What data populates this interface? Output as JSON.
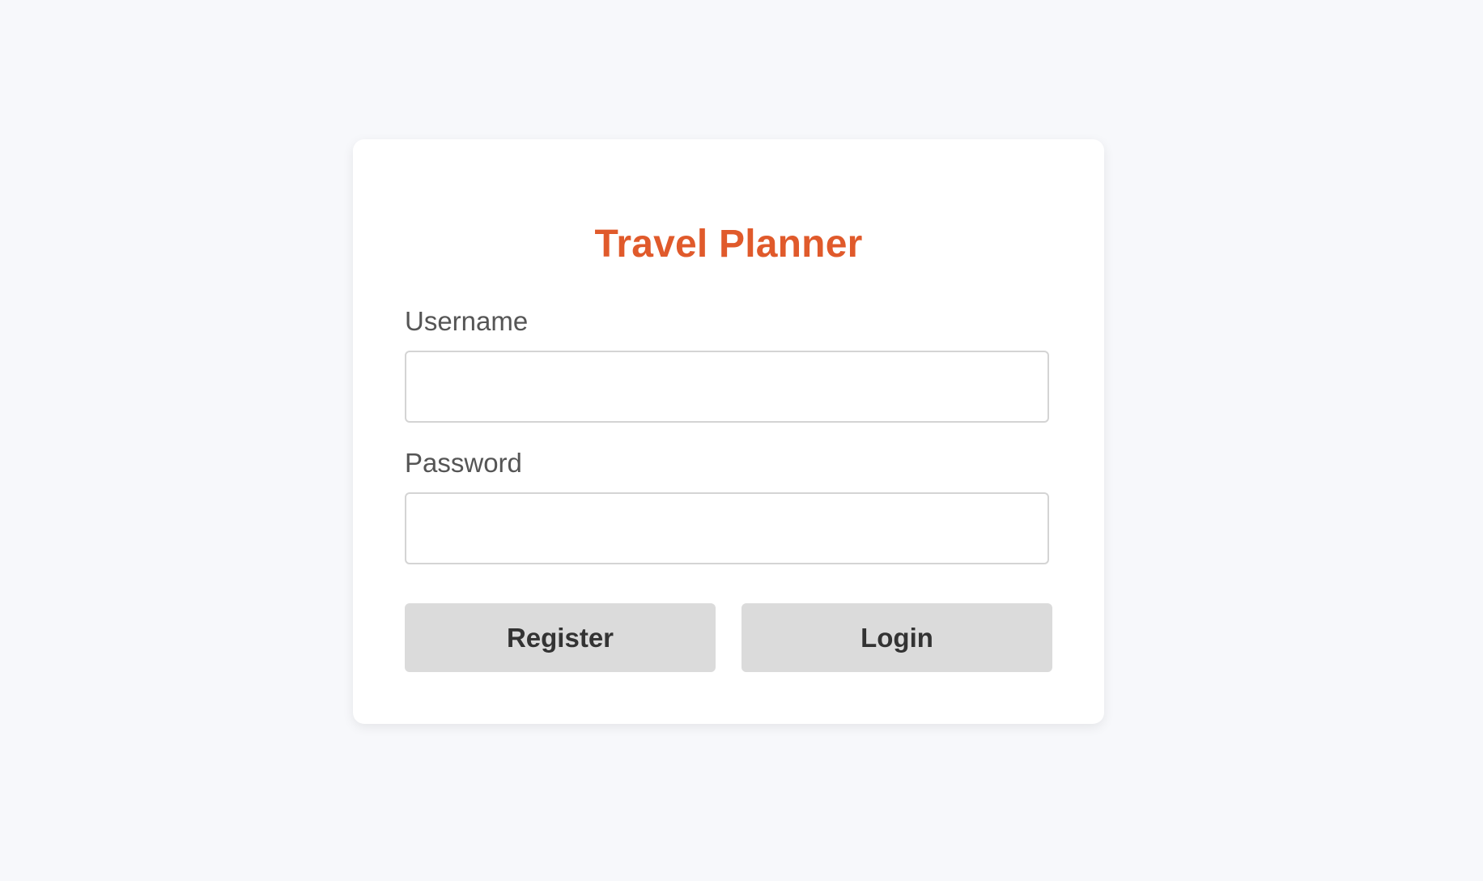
{
  "app": {
    "title": "Travel Planner"
  },
  "form": {
    "username": {
      "label": "Username",
      "value": "",
      "placeholder": ""
    },
    "password": {
      "label": "Password",
      "value": "",
      "placeholder": ""
    }
  },
  "actions": {
    "register_label": "Register",
    "login_label": "Login"
  },
  "colors": {
    "accent": "#e05a2b",
    "background": "#f7f8fb",
    "card": "#ffffff",
    "button": "#dbdbdb"
  }
}
